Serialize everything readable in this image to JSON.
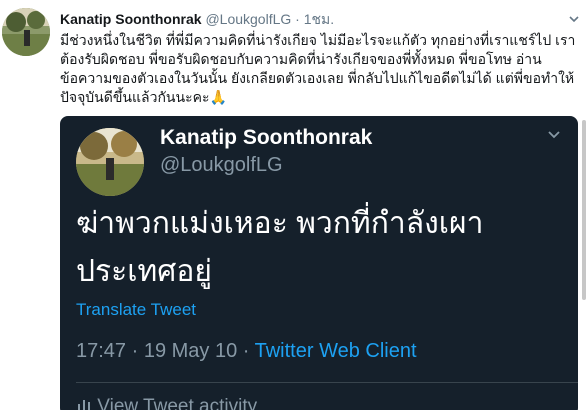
{
  "tweet": {
    "display_name": "Kanatip Soonthonrak",
    "handle": "@LoukgolfLG",
    "separator": "·",
    "time": "1ชม.",
    "menu_icon": "chevron-down-icon",
    "text": "มีช่วงหนึ่งในชีวิต ที่พี่มีความคิดที่น่ารังเกียจ ไม่มีอะไรจะแก้ตัว ทุกอย่างที่เราแชร์ไป เราต้องรับผิดชอบ พี่ขอรับผิดชอบกับความคิดที่น่ารังเกียจของพี่ทั้งหมด พี่ขอโทษ อ่านข้อความของตัวเองในวันนั้น ยังเกลียดตัวเองเลย พี่กลับไปแก้ไขอดีตไม่ได้ แต่พี่ขอทำให้ปัจจุบันดีขึ้นแล้วกันนะคะ",
    "emoji": "🙏"
  },
  "embedded_tweet": {
    "display_name": "Kanatip Soonthonrak",
    "handle": "@LoukgolfLG",
    "menu_icon": "chevron-down-icon",
    "text": "ฆ่าพวกแม่งเหอะ พวกที่กำลังเผาประเทศอยู่",
    "translate_label": "Translate Tweet",
    "timestamp": "17:47 · 19 May 10 · ",
    "client": "Twitter Web Client",
    "activity_icon": "bar-chart-icon",
    "activity_label": "View Tweet activity"
  },
  "colors": {
    "link": "#1da1f2",
    "dark_bg": "#15202b",
    "muted": "#657786"
  }
}
